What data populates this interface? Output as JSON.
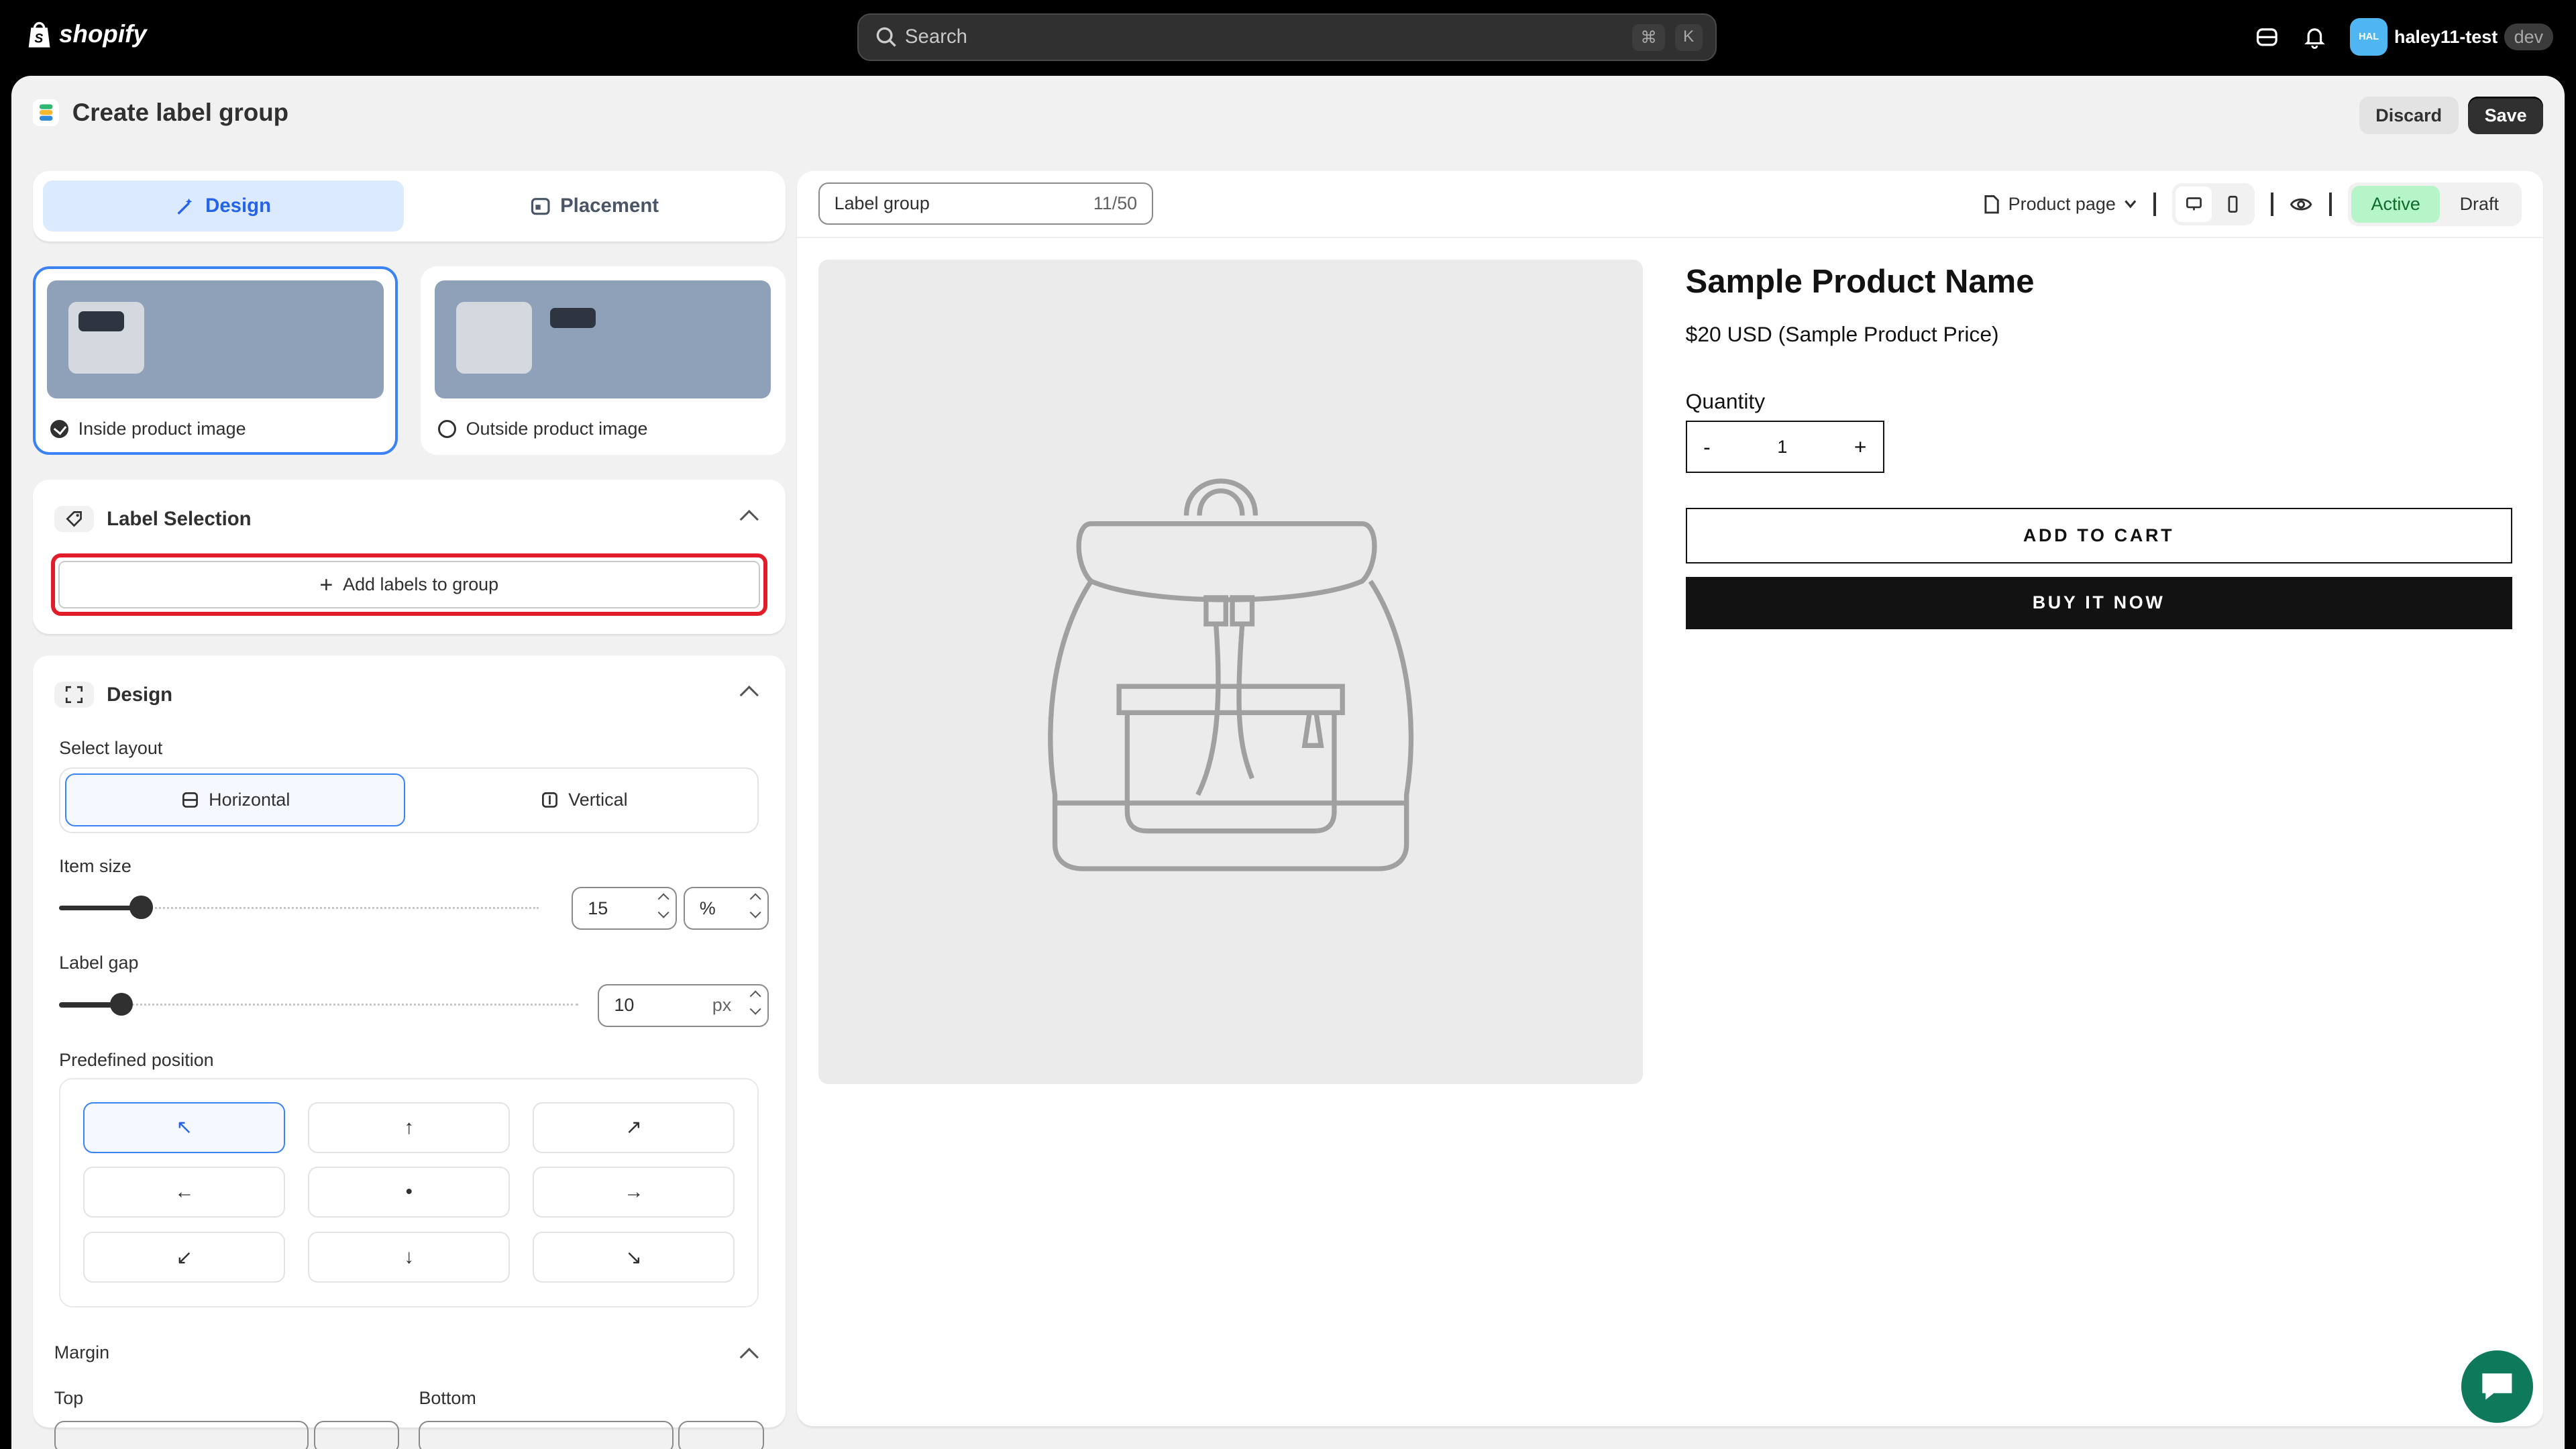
{
  "topbar": {
    "brand": "shopify",
    "search_placeholder": "Search",
    "shortcut_cmd": "⌘",
    "shortcut_key": "K",
    "avatar_initials": "HAL",
    "username": "haley11-test",
    "env_tag": "dev"
  },
  "header": {
    "title": "Create label group",
    "discard_label": "Discard",
    "save_label": "Save"
  },
  "tabs": [
    {
      "label": "Design",
      "active": true
    },
    {
      "label": "Placement",
      "active": false
    }
  ],
  "position_options": [
    {
      "label": "Inside product image",
      "selected": true
    },
    {
      "label": "Outside product image",
      "selected": false
    }
  ],
  "label_selection": {
    "title": "Label Selection",
    "add_button": "Add labels to group"
  },
  "design": {
    "title": "Design",
    "select_layout_label": "Select layout",
    "layouts": [
      {
        "label": "Horizontal",
        "active": true
      },
      {
        "label": "Vertical",
        "active": false
      }
    ],
    "item_size_label": "Item size",
    "item_size_value": "15",
    "item_size_unit": "%",
    "item_size_slider_percent": 17,
    "label_gap_label": "Label gap",
    "label_gap_value": "10",
    "label_gap_unit": "px",
    "label_gap_slider_percent": 12,
    "predefined_position_label": "Predefined position",
    "positions": [
      "↖",
      "↑",
      "↗",
      "←",
      "•",
      "→",
      "↙",
      "↓",
      "↘"
    ],
    "active_position": 0,
    "margin_label": "Margin",
    "top_label": "Top",
    "bottom_label": "Bottom"
  },
  "preview": {
    "group_name": "Label group",
    "name_counter": "11/50",
    "page_select": "Product page",
    "status_active": "Active",
    "status_draft": "Draft",
    "product_title": "Sample Product Name",
    "product_price": "$20 USD (Sample Product Price)",
    "quantity_label": "Quantity",
    "qty_minus": "-",
    "qty_value": "1",
    "qty_plus": "+",
    "add_to_cart": "ADD TO CART",
    "buy_now": "BUY IT NOW"
  },
  "colors": {
    "accent_blue": "#3b82f6",
    "highlight_red": "#e11d2a",
    "active_green": "#b6f5c8",
    "chat_green": "#0f7a5b"
  }
}
